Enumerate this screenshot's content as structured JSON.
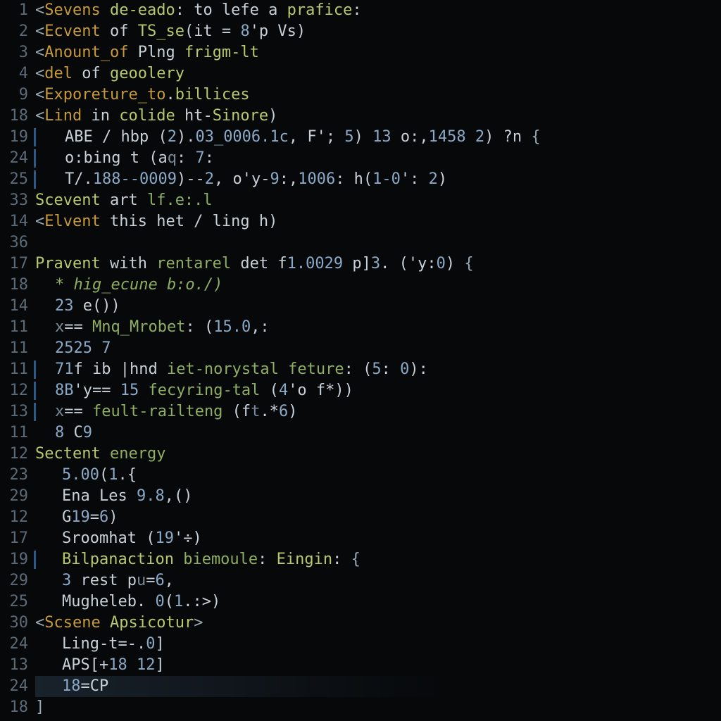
{
  "gutter": [
    "1",
    "2",
    "3",
    "4",
    "9",
    "18",
    "19",
    "24",
    "25",
    "33",
    "14",
    "36",
    "17",
    "18",
    "14",
    "11",
    "11",
    "11",
    "12",
    "13",
    "11",
    "12",
    "23",
    "29",
    "12",
    "17",
    "19",
    "29",
    "25",
    "30",
    "24",
    "13",
    "24",
    "18"
  ],
  "lines": [
    {
      "cls": "",
      "segs": [
        [
          "op",
          "<"
        ],
        [
          "tagc",
          "Sevens"
        ],
        [
          "txt",
          " "
        ],
        [
          "fn",
          "de-eado"
        ],
        [
          "txt",
          ": to lefe a "
        ],
        [
          "fn",
          "prafice"
        ],
        [
          "txt",
          ":"
        ]
      ]
    },
    {
      "cls": "",
      "segs": [
        [
          "op",
          "<"
        ],
        [
          "tagc",
          "Ecvent"
        ],
        [
          "txt",
          " of "
        ],
        [
          "fn",
          "TS_se"
        ],
        [
          "txt",
          "(it = "
        ],
        [
          "num",
          "8"
        ],
        [
          "txt",
          "'p Vs)"
        ]
      ]
    },
    {
      "cls": "",
      "segs": [
        [
          "op",
          "<"
        ],
        [
          "tagc",
          "Anount_of"
        ],
        [
          "txt",
          " Plng "
        ],
        [
          "fn",
          "frigm-lt"
        ]
      ]
    },
    {
      "cls": "",
      "segs": [
        [
          "op",
          "<"
        ],
        [
          "tagc",
          "del"
        ],
        [
          "txt",
          " of "
        ],
        [
          "fn",
          "geoolery"
        ]
      ]
    },
    {
      "cls": "",
      "segs": [
        [
          "op",
          "<"
        ],
        [
          "tagc",
          "Exporeture_to"
        ],
        [
          "txt",
          "."
        ],
        [
          "fn",
          "billices"
        ]
      ]
    },
    {
      "cls": "",
      "segs": [
        [
          "op",
          "<"
        ],
        [
          "tagc",
          "Lind"
        ],
        [
          "txt",
          " in "
        ],
        [
          "fn",
          "colide"
        ],
        [
          "txt",
          " ht-"
        ],
        [
          "fn",
          "Sinore"
        ],
        [
          "txt",
          ")"
        ]
      ]
    },
    {
      "cls": "bar indent1",
      "segs": [
        [
          "txt",
          "ABE / hbp ("
        ],
        [
          "num",
          "2"
        ],
        [
          "txt",
          ")."
        ],
        [
          "num",
          "03_0006.1c"
        ],
        [
          "txt",
          ", F'; "
        ],
        [
          "num",
          "5"
        ],
        [
          "txt",
          ") "
        ],
        [
          "num",
          "13"
        ],
        [
          "txt",
          " o:,"
        ],
        [
          "num",
          "1458 2"
        ],
        [
          "txt",
          ") ?n "
        ],
        [
          "op",
          "{"
        ]
      ]
    },
    {
      "cls": "bar indent1",
      "segs": [
        [
          "txt",
          "o:bing t (a"
        ],
        [
          "dim",
          "q"
        ],
        [
          "txt",
          ": "
        ],
        [
          "num",
          "7"
        ],
        [
          "txt",
          ":"
        ]
      ]
    },
    {
      "cls": "bar indent1",
      "segs": [
        [
          "txt",
          "T/."
        ],
        [
          "num",
          "188--0009"
        ],
        [
          "txt",
          ")--"
        ],
        [
          "num",
          "2"
        ],
        [
          "txt",
          ", o'y-"
        ],
        [
          "num",
          "9"
        ],
        [
          "txt",
          ":,"
        ],
        [
          "num",
          "1006"
        ],
        [
          "txt",
          ": h("
        ],
        [
          "num",
          "1-0"
        ],
        [
          "txt",
          "': "
        ],
        [
          "num",
          "2"
        ],
        [
          "txt",
          ")"
        ]
      ]
    },
    {
      "cls": "",
      "segs": [
        [
          "fn",
          "Scevent"
        ],
        [
          "txt",
          " art "
        ],
        [
          "str",
          "lf.e:.l"
        ]
      ]
    },
    {
      "cls": "",
      "segs": [
        [
          "op",
          "<"
        ],
        [
          "tagc",
          "Elvent"
        ],
        [
          "txt",
          " this het / ling h)"
        ]
      ]
    },
    {
      "cls": "",
      "segs": [
        [
          "txt",
          ""
        ]
      ]
    },
    {
      "cls": "",
      "segs": [
        [
          "fn",
          "Pravent"
        ],
        [
          "txt",
          " with "
        ],
        [
          "str",
          "rentarel"
        ],
        [
          "txt",
          " det f"
        ],
        [
          "num",
          "1.0029"
        ],
        [
          "txt",
          " p]"
        ],
        [
          "num",
          "3"
        ],
        [
          "txt",
          ". ('y:"
        ],
        [
          "num",
          "0"
        ],
        [
          "txt",
          ") "
        ],
        [
          "op",
          "{"
        ]
      ]
    },
    {
      "cls": "indent2",
      "segs": [
        [
          "cmt",
          "* hig_ecune b:o./)"
        ]
      ]
    },
    {
      "cls": "indent2",
      "segs": [
        [
          "num",
          "23"
        ],
        [
          "txt",
          " e())"
        ]
      ]
    },
    {
      "cls": "indent2",
      "segs": [
        [
          "dim",
          "x"
        ],
        [
          "txt",
          "== "
        ],
        [
          "str",
          "Mnq_Mrobet"
        ],
        [
          "txt",
          ": ("
        ],
        [
          "num",
          "15.0"
        ],
        [
          "txt",
          ",:"
        ]
      ]
    },
    {
      "cls": "indent2",
      "segs": [
        [
          "num",
          "2525 7"
        ]
      ]
    },
    {
      "cls": "bar indent2",
      "segs": [
        [
          "num",
          "71"
        ],
        [
          "txt",
          "f ib |hnd "
        ],
        [
          "str",
          "iet-norystal feture"
        ],
        [
          "txt",
          ": ("
        ],
        [
          "num",
          "5"
        ],
        [
          "txt",
          ": "
        ],
        [
          "num",
          "0"
        ],
        [
          "txt",
          "):"
        ]
      ]
    },
    {
      "cls": "bar indent2",
      "segs": [
        [
          "num",
          "8B"
        ],
        [
          "txt",
          "'y== "
        ],
        [
          "num",
          "15"
        ],
        [
          "txt",
          " "
        ],
        [
          "str",
          "fecyring-tal"
        ],
        [
          "txt",
          " ("
        ],
        [
          "num",
          "4"
        ],
        [
          "txt",
          "'o f*))"
        ]
      ]
    },
    {
      "cls": "bar indent2",
      "segs": [
        [
          "dim",
          "x"
        ],
        [
          "txt",
          "== "
        ],
        [
          "str",
          "feult-railteng"
        ],
        [
          "txt",
          " (f"
        ],
        [
          "dim",
          "t"
        ],
        [
          "txt",
          ".*"
        ],
        [
          "num",
          "6"
        ],
        [
          "txt",
          ")"
        ]
      ]
    },
    {
      "cls": "indent2",
      "segs": [
        [
          "num",
          "8"
        ],
        [
          "txt",
          " C"
        ],
        [
          "num",
          "9"
        ]
      ]
    },
    {
      "cls": "",
      "segs": [
        [
          "fn",
          "Sectent"
        ],
        [
          "txt",
          " "
        ],
        [
          "str",
          "energy"
        ]
      ]
    },
    {
      "cls": "indent3",
      "segs": [
        [
          "num",
          "5.00"
        ],
        [
          "txt",
          "("
        ],
        [
          "num",
          "1"
        ],
        [
          "txt",
          ".{"
        ]
      ]
    },
    {
      "cls": "indent3",
      "segs": [
        [
          "txt",
          "Ena Les "
        ],
        [
          "num",
          "9.8"
        ],
        [
          "txt",
          ",()"
        ]
      ]
    },
    {
      "cls": "indent3",
      "segs": [
        [
          "txt",
          "G"
        ],
        [
          "num",
          "19"
        ],
        [
          "txt",
          "="
        ],
        [
          "num",
          "6"
        ],
        [
          "txt",
          ")"
        ]
      ]
    },
    {
      "cls": "indent3",
      "segs": [
        [
          "txt",
          "Sroomhat ("
        ],
        [
          "num",
          "19"
        ],
        [
          "txt",
          "'÷)"
        ]
      ]
    },
    {
      "cls": "bar indent3",
      "segs": [
        [
          "fn",
          "Bilpanaction"
        ],
        [
          "txt",
          " "
        ],
        [
          "str",
          "biemoule"
        ],
        [
          "txt",
          ": "
        ],
        [
          "fn",
          "Eingin"
        ],
        [
          "txt",
          ": "
        ],
        [
          "op",
          "{"
        ]
      ]
    },
    {
      "cls": "indent3",
      "segs": [
        [
          "num",
          "3"
        ],
        [
          "txt",
          " rest p"
        ],
        [
          "dim",
          "u"
        ],
        [
          "txt",
          "="
        ],
        [
          "num",
          "6"
        ],
        [
          "txt",
          ","
        ]
      ]
    },
    {
      "cls": "indent3",
      "segs": [
        [
          "txt",
          "Mugheleb. "
        ],
        [
          "num",
          "0"
        ],
        [
          "txt",
          "("
        ],
        [
          "num",
          "1"
        ],
        [
          "txt",
          ".:>)"
        ]
      ]
    },
    {
      "cls": "",
      "segs": [
        [
          "op",
          "<"
        ],
        [
          "tagc",
          "Scsene"
        ],
        [
          "txt",
          " "
        ],
        [
          "fn",
          "Apsicotur"
        ],
        [
          "op",
          ">"
        ]
      ]
    },
    {
      "cls": "indent3",
      "segs": [
        [
          "txt",
          "Ling-t=-."
        ],
        [
          "num",
          "0"
        ],
        [
          "txt",
          "]"
        ]
      ]
    },
    {
      "cls": "indent3",
      "segs": [
        [
          "txt",
          "APS[+"
        ],
        [
          "num",
          "18 12"
        ],
        [
          "txt",
          "]"
        ]
      ]
    },
    {
      "cls": "indent3 current",
      "segs": [
        [
          "num",
          "18"
        ],
        [
          "txt",
          "=CP"
        ]
      ]
    },
    {
      "cls": "",
      "segs": [
        [
          "op",
          "]"
        ]
      ]
    }
  ]
}
